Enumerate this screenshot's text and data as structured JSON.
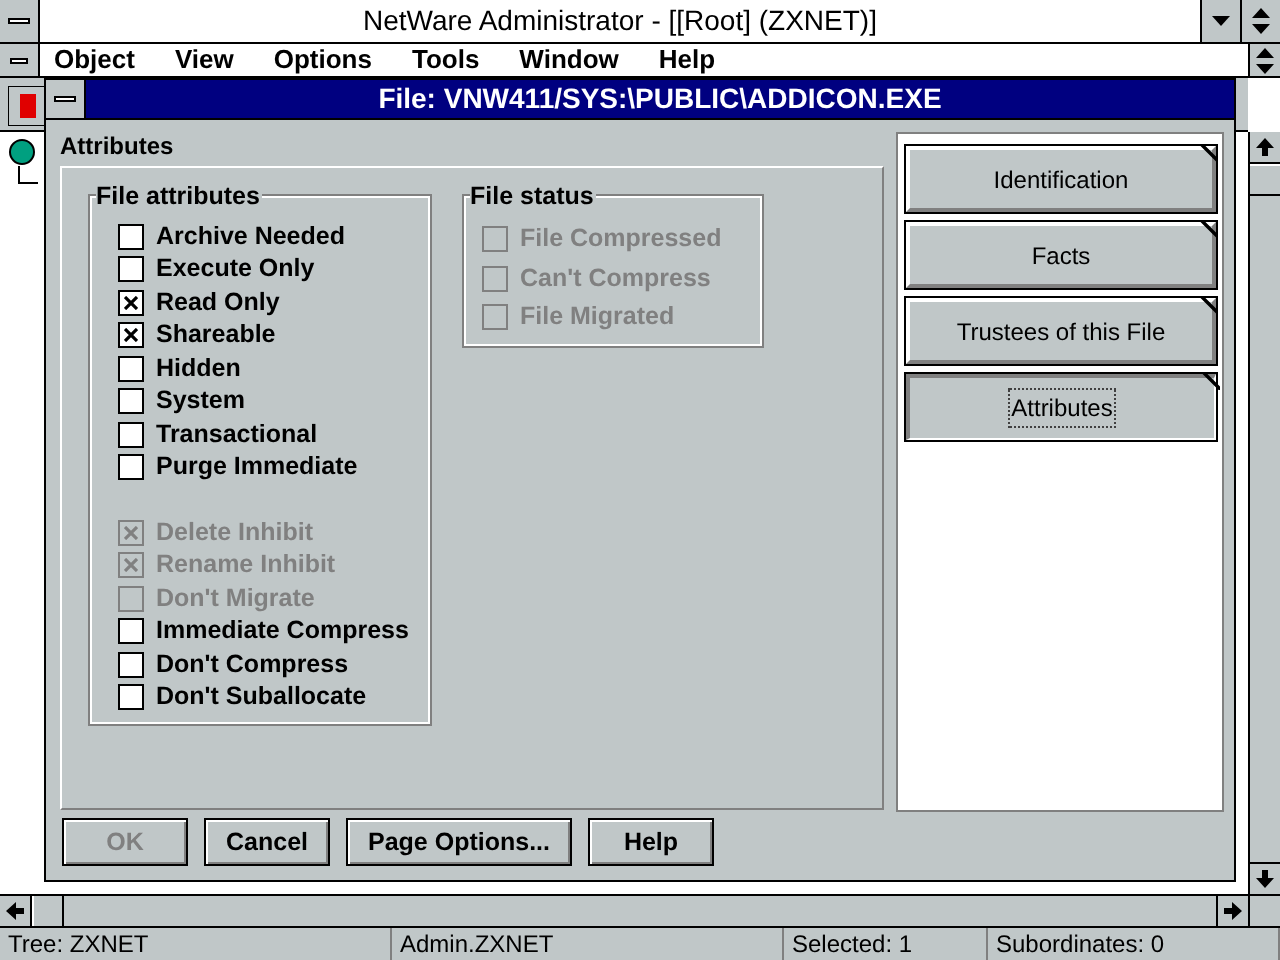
{
  "window": {
    "title": "NetWare Administrator - [[Root] (ZXNET)]"
  },
  "menus": [
    {
      "label": "Object"
    },
    {
      "label": "View"
    },
    {
      "label": "Options"
    },
    {
      "label": "Tools"
    },
    {
      "label": "Window"
    },
    {
      "label": "Help"
    }
  ],
  "dialog": {
    "title": "File: VNW411/SYS:\\PUBLIC\\ADDICON.EXE",
    "section_label": "Attributes",
    "file_attributes": {
      "label": "File attributes",
      "groups": [
        [
          {
            "label": "Archive Needed",
            "checked": false,
            "disabled": false
          },
          {
            "label": "Execute Only",
            "checked": false,
            "disabled": false
          },
          {
            "label": "Read Only",
            "checked": true,
            "disabled": false
          },
          {
            "label": "Shareable",
            "checked": true,
            "disabled": false
          },
          {
            "label": "Hidden",
            "checked": false,
            "disabled": false
          },
          {
            "label": "System",
            "checked": false,
            "disabled": false
          },
          {
            "label": "Transactional",
            "checked": false,
            "disabled": false
          },
          {
            "label": "Purge Immediate",
            "checked": false,
            "disabled": false
          }
        ],
        [
          {
            "label": "Delete Inhibit",
            "checked": true,
            "disabled": true
          },
          {
            "label": "Rename Inhibit",
            "checked": true,
            "disabled": true
          },
          {
            "label": "Don't Migrate",
            "checked": false,
            "disabled": true
          },
          {
            "label": "Immediate Compress",
            "checked": false,
            "disabled": false
          },
          {
            "label": "Don't Compress",
            "checked": false,
            "disabled": false
          },
          {
            "label": "Don't Suballocate",
            "checked": false,
            "disabled": false
          }
        ]
      ]
    },
    "file_status": {
      "label": "File status",
      "items": [
        {
          "label": "File Compressed",
          "checked": false,
          "disabled": true
        },
        {
          "label": "Can't Compress",
          "checked": false,
          "disabled": true
        },
        {
          "label": "File Migrated",
          "checked": false,
          "disabled": true
        }
      ]
    },
    "pages": [
      {
        "label": "Identification",
        "selected": false
      },
      {
        "label": "Facts",
        "selected": false
      },
      {
        "label": "Trustees of this File",
        "selected": false
      },
      {
        "label": "Attributes",
        "selected": true
      }
    ],
    "buttons": [
      {
        "label": "OK",
        "disabled": true
      },
      {
        "label": "Cancel",
        "disabled": false
      },
      {
        "label": "Page Options...",
        "disabled": false
      },
      {
        "label": "Help",
        "disabled": false
      }
    ]
  },
  "status_bar": [
    {
      "text": "Tree: ZXNET"
    },
    {
      "text": "Admin.ZXNET"
    },
    {
      "text": "Selected: 1"
    },
    {
      "text": "Subordinates: 0"
    }
  ]
}
